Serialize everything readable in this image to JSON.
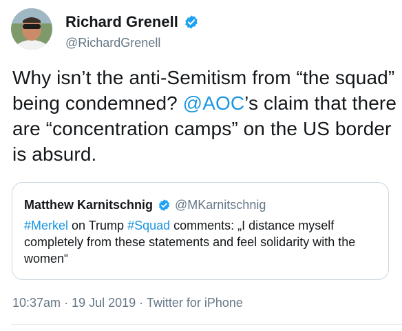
{
  "author": {
    "name": "Richard Grenell",
    "handle": "@RichardGrenell",
    "verified_icon": "verified-badge-icon"
  },
  "tweet": {
    "text_part1": "Why isn’t the anti-Semitism from “the squad” being condemned? ",
    "mention": "@AOC",
    "text_part2": "’s claim that there are “concentration camps” on the US border is absurd."
  },
  "quoted": {
    "name": "Matthew Karnitschnig",
    "handle": "@MKarnitschnig",
    "hashtag1": "#Merkel",
    "text_part1": " on Trump ",
    "hashtag2": "#Squad",
    "text_part2": " comments: „I distance myself completely from these statements and feel solidarity with the women“"
  },
  "meta": {
    "time": "10:37am",
    "separator1": " · ",
    "date": "19 Jul 2019",
    "separator2": " · ",
    "source": "Twitter for iPhone"
  },
  "colors": {
    "link": "#1b95e0",
    "secondary_text": "#657786",
    "border": "#ccd6dd",
    "verified": "#1da1f2"
  }
}
